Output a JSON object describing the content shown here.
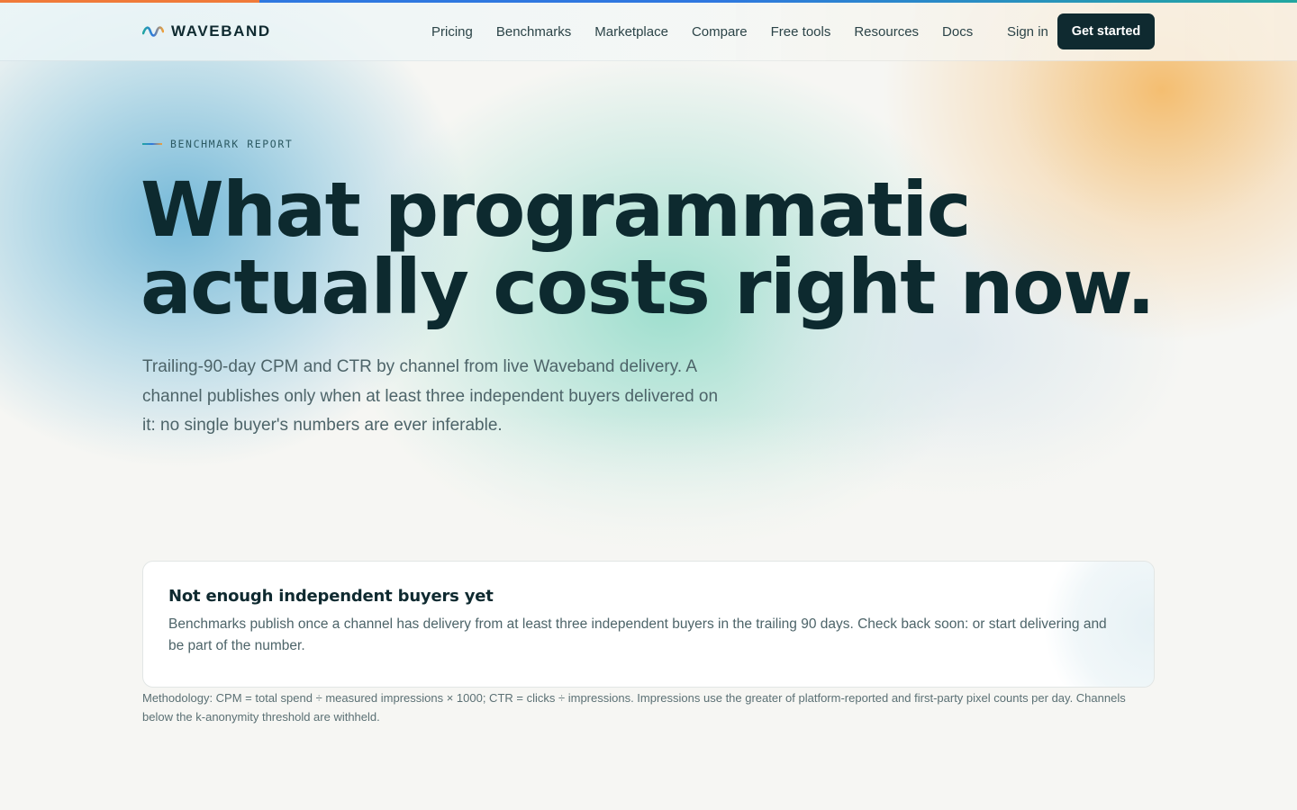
{
  "brand": {
    "name": "WAVEBAND",
    "logo_icon": "wave-logo-icon",
    "colors": {
      "ink": "#0f2a30",
      "accent_orange": "#f07a3a",
      "accent_blue": "#2f78e0",
      "accent_teal": "#22a7a0"
    }
  },
  "nav": {
    "items": [
      "Pricing",
      "Benchmarks",
      "Marketplace",
      "Compare",
      "Free tools",
      "Resources",
      "Docs"
    ],
    "sign_in": "Sign in",
    "cta": "Get started"
  },
  "hero": {
    "eyebrow": "BENCHMARK REPORT",
    "headline_line1": "What programmatic",
    "headline_line2": "actually costs right now.",
    "lede": "Trailing-90-day CPM and CTR by channel from live Waveband delivery. A channel publishes only when at least three independent buyers delivered on it: no single buyer's numbers are ever inferable."
  },
  "notice": {
    "title": "Not enough independent buyers yet",
    "body": "Benchmarks publish once a channel has delivery from at least three independent buyers in the trailing 90 days. Check back soon: or start delivering and be part of the number."
  },
  "methodology": "Methodology: CPM = total spend ÷ measured impressions × 1000; CTR = clicks ÷ impressions. Impressions use the greater of platform-reported and first-party pixel counts per day. Channels below the k-anonymity threshold are withheld."
}
